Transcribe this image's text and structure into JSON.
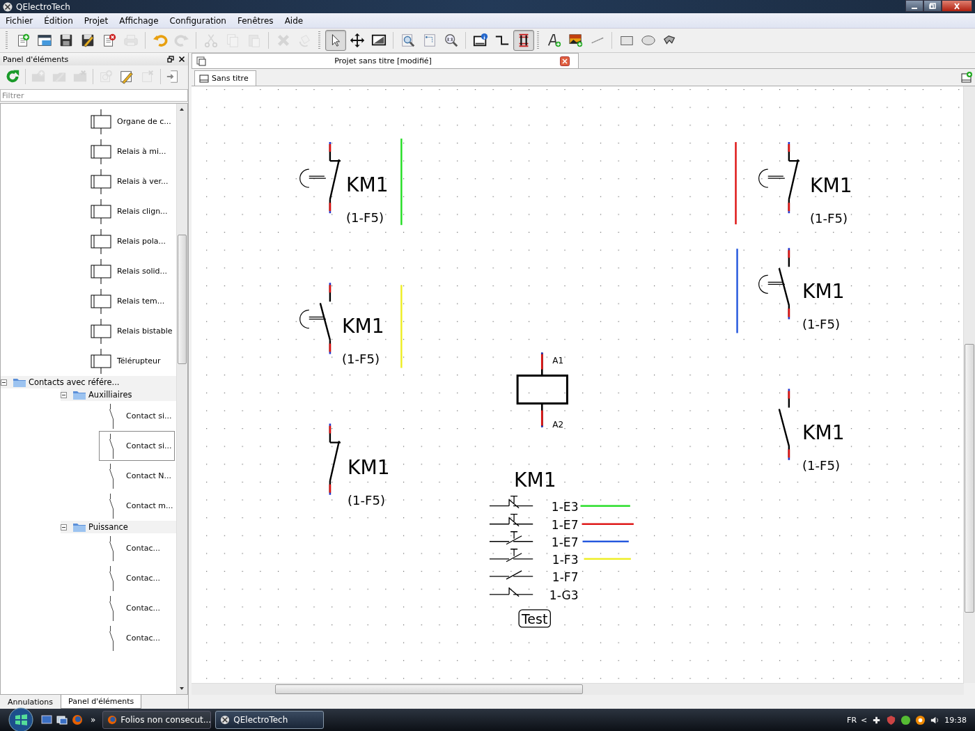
{
  "window": {
    "title": "QElectroTech"
  },
  "menu": [
    "Fichier",
    "Édition",
    "Projet",
    "Affichage",
    "Configuration",
    "Fenêtres",
    "Aide"
  ],
  "toolbar": [
    {
      "disabled": false,
      "pressed": false
    },
    {
      "disabled": false,
      "pressed": false
    },
    {
      "disabled": false,
      "pressed": false
    },
    {
      "disabled": false,
      "pressed": false
    },
    {
      "disabled": false,
      "pressed": false
    },
    {
      "disabled": true,
      "pressed": false
    },
    {
      "disabled": false,
      "pressed": false
    },
    {
      "disabled": true,
      "pressed": false
    },
    {
      "disabled": true,
      "pressed": false
    },
    {
      "disabled": true,
      "pressed": false
    },
    {
      "disabled": true,
      "pressed": false
    },
    {
      "disabled": true,
      "pressed": false
    },
    {
      "disabled": true,
      "pressed": false
    },
    {
      "disabled": false,
      "pressed": true
    },
    {
      "disabled": false,
      "pressed": false
    },
    {
      "disabled": false,
      "pressed": false
    },
    {
      "disabled": false,
      "pressed": false
    },
    {
      "disabled": false,
      "pressed": false
    },
    {
      "disabled": false,
      "pressed": false
    },
    {
      "disabled": false,
      "pressed": false
    },
    {
      "disabled": false,
      "pressed": false
    },
    {
      "disabled": false,
      "pressed": true
    },
    {
      "disabled": false,
      "pressed": false
    },
    {
      "disabled": false,
      "pressed": false
    },
    {
      "disabled": false,
      "pressed": false
    },
    {
      "disabled": false,
      "pressed": false
    },
    {
      "disabled": false,
      "pressed": false
    },
    {
      "disabled": false,
      "pressed": false
    }
  ],
  "dock": {
    "title": "Panel d'éléments",
    "tools": [
      {
        "disabled": false
      },
      {
        "disabled": true
      },
      {
        "disabled": true
      },
      {
        "disabled": true
      },
      {
        "disabled": true
      },
      {
        "disabled": false
      },
      {
        "disabled": true
      },
      {
        "disabled": false
      }
    ],
    "filter": {
      "placeholder": "Filtrer"
    },
    "tree": [
      {
        "kind": "coil",
        "label": "Organe de c...",
        "selected": false
      },
      {
        "kind": "coil",
        "label": "Relais à mi...",
        "selected": false
      },
      {
        "kind": "coil",
        "label": "Relais à ver...",
        "selected": false
      },
      {
        "kind": "coil",
        "label": "Relais clign...",
        "selected": false
      },
      {
        "kind": "coil",
        "label": "Relais pola...",
        "selected": false
      },
      {
        "kind": "coil",
        "label": "Relais solid...",
        "selected": false
      },
      {
        "kind": "coil",
        "label": "Relais tem...",
        "selected": false
      },
      {
        "kind": "coil",
        "label": "Relais bistable",
        "selected": false
      },
      {
        "kind": "coil",
        "label": "Télérupteur",
        "selected": false
      },
      {
        "kind": "folder",
        "label": "Contacts avec référe...",
        "selected": false,
        "expanded": true,
        "children": [
          {
            "kind": "folder",
            "label": "Auxilliaires",
            "selected": false,
            "expanded": true,
            "children": [
              {
                "kind": "contact",
                "label": "Contact si...",
                "selected": false
              },
              {
                "kind": "contact",
                "label": "Contact si...",
                "selected": true
              },
              {
                "kind": "contact",
                "label": "Contact N...",
                "selected": false
              },
              {
                "kind": "contact",
                "label": "Contact m...",
                "selected": false
              }
            ]
          },
          {
            "kind": "folder",
            "label": "Puissance",
            "selected": false,
            "expanded": true,
            "children": [
              {
                "kind": "contact",
                "label": "Contac...",
                "selected": false
              },
              {
                "kind": "contact",
                "label": "Contac...",
                "selected": false
              },
              {
                "kind": "contact",
                "label": "Contac...",
                "selected": false
              },
              {
                "kind": "contact",
                "label": "Contac...",
                "selected": false
              }
            ]
          }
        ]
      }
    ],
    "tabs": [
      {
        "label": "Annulations",
        "selected": false
      },
      {
        "label": "Panel d'éléments",
        "selected": true
      }
    ]
  },
  "project": {
    "title": "Projet sans titre [modifié]",
    "folios": [
      {
        "label": "Sans titre",
        "selected": true
      }
    ]
  },
  "diagram": {
    "contacts": [
      {
        "kind": "nc-push",
        "label": "KM1",
        "reference": "(1-F5)"
      },
      {
        "kind": "no-push",
        "label": "KM1",
        "reference": "(1-F5)"
      },
      {
        "kind": "nc",
        "label": "KM1",
        "reference": "(1-F5)"
      },
      {
        "kind": "nc-push",
        "label": "KM1",
        "reference": "(1-F5)"
      },
      {
        "kind": "no-push",
        "label": "KM1",
        "reference": "(1-F5)"
      },
      {
        "kind": "no",
        "label": "KM1",
        "reference": "(1-F5)"
      }
    ],
    "wires": [
      {
        "color": "#22dd22"
      },
      {
        "color": "#eeee22"
      },
      {
        "color": "#dd1111"
      },
      {
        "color": "#2255dd"
      }
    ],
    "coil": {
      "terminals": [
        "A1",
        "A2"
      ]
    },
    "xref": {
      "title": "KM1",
      "rows": [
        {
          "kind": "nc-push",
          "reference": "1-E3",
          "color": "#22dd22"
        },
        {
          "kind": "nc-push",
          "reference": "1-E7",
          "color": "#dd1111"
        },
        {
          "kind": "no-push",
          "reference": "1-E7",
          "color": "#2255dd"
        },
        {
          "kind": "no-push",
          "reference": "1-F3",
          "color": "#eeee22"
        },
        {
          "kind": "no",
          "reference": "1-F7"
        },
        {
          "kind": "nc",
          "reference": "1-G3"
        }
      ]
    },
    "text_box": "Test"
  },
  "taskbar": {
    "overflow": "»",
    "tasks": [
      {
        "label": "Folios non consecut...",
        "selected": false
      },
      {
        "label": "QElectroTech",
        "selected": true
      }
    ],
    "language": "FR",
    "tray_expand": "<",
    "clock": "19:38"
  }
}
